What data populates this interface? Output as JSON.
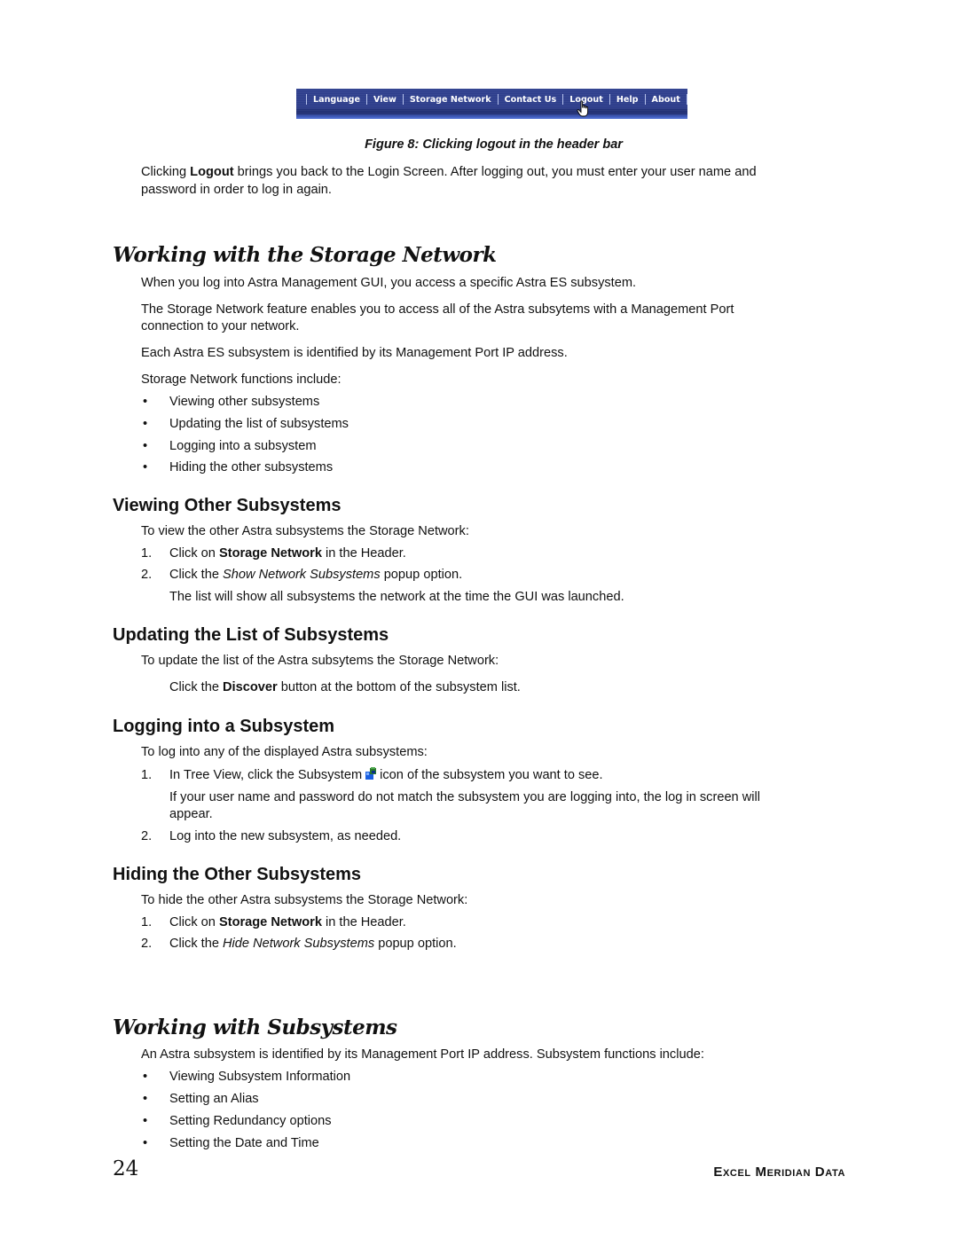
{
  "figure": {
    "header_bar": {
      "items": [
        "Language",
        "View",
        "Storage Network",
        "Contact Us",
        "Logout",
        "Help",
        "About"
      ],
      "active_item": "Logout",
      "colors": {
        "bar": "#2c3c8a",
        "bottom_accent": "#4a6ad0",
        "text": "#ffffff"
      }
    },
    "caption": "Figure 8: Clicking logout in the header bar"
  },
  "intro": {
    "pre": "Clicking ",
    "bold": "Logout",
    "post_line1": " brings you back to the Login Screen. After logging out, you must enter your user name and",
    "line2": "password in order to log in again."
  },
  "section_storage": {
    "title": "Working with the Storage Network",
    "p1": "When you log into Astra Management GUI, you access a specific Astra ES subsystem.",
    "p2_line1": "The Storage Network feature enables you to access all of the Astra subsytems with a Management Port",
    "p2_line2": "connection to your network.",
    "p3": "Each Astra ES subsystem is identified by its Management Port IP address.",
    "p4": "Storage Network functions include:",
    "bullet": "•",
    "functions": [
      "Viewing other subsystems",
      "Updating the list of subsystems",
      "Logging into a subsystem",
      "Hiding the other subsystems"
    ]
  },
  "viewing": {
    "title": "Viewing Other Subsystems",
    "intro": "To view the other Astra subsystems the Storage Network:",
    "step1": {
      "num": "1.",
      "pre": "Click on ",
      "bold": "Storage Network",
      "post": " in the Header."
    },
    "step2": {
      "num": "2.",
      "pre": "Click the ",
      "italic": "Show Network Subsystems",
      "post": " popup option."
    },
    "note": "The list will show all subsystems the network at the time the GUI was launched."
  },
  "updating": {
    "title": "Updating the List of Subsystems",
    "intro": "To update the list of the Astra subsytems the Storage Network:",
    "step": {
      "pre": "Click the ",
      "bold": "Discover",
      "post": " button at the bottom of the subsystem list."
    }
  },
  "logging": {
    "title": "Logging into a Subsystem",
    "intro": "To log into any of the displayed Astra subsystems:",
    "step1": {
      "num": "1.",
      "pre": "In Tree View, click the Subsystem",
      "icon": "subsystem-icon",
      "post": "icon of the subsystem you want to see."
    },
    "note_line1": "If your user name and password do not match the subsystem you are logging into, the log in screen will",
    "note_line2": "appear.",
    "step2": {
      "num": "2.",
      "text": "Log into the new subsystem, as needed."
    }
  },
  "hiding": {
    "title": "Hiding the Other Subsystems",
    "intro": "To hide the other Astra subsystems the Storage Network:",
    "step1": {
      "num": "1.",
      "pre": "Click on ",
      "bold": "Storage Network",
      "post": " in the Header."
    },
    "step2": {
      "num": "2.",
      "pre": "Click the ",
      "italic": "Hide Network Subsystems",
      "post": " popup option."
    }
  },
  "section_subsystems": {
    "title": "Working with Subsystems",
    "intro": "An Astra subsystem is identified by its Management Port IP address. Subsystem functions include:",
    "bullet": "•",
    "functions": [
      "Viewing Subsystem Information",
      "Setting an Alias",
      "Setting Redundancy options",
      "Setting the Date and Time"
    ]
  },
  "footer": {
    "page_number": "24",
    "brand": "Excel Meridian Data"
  }
}
